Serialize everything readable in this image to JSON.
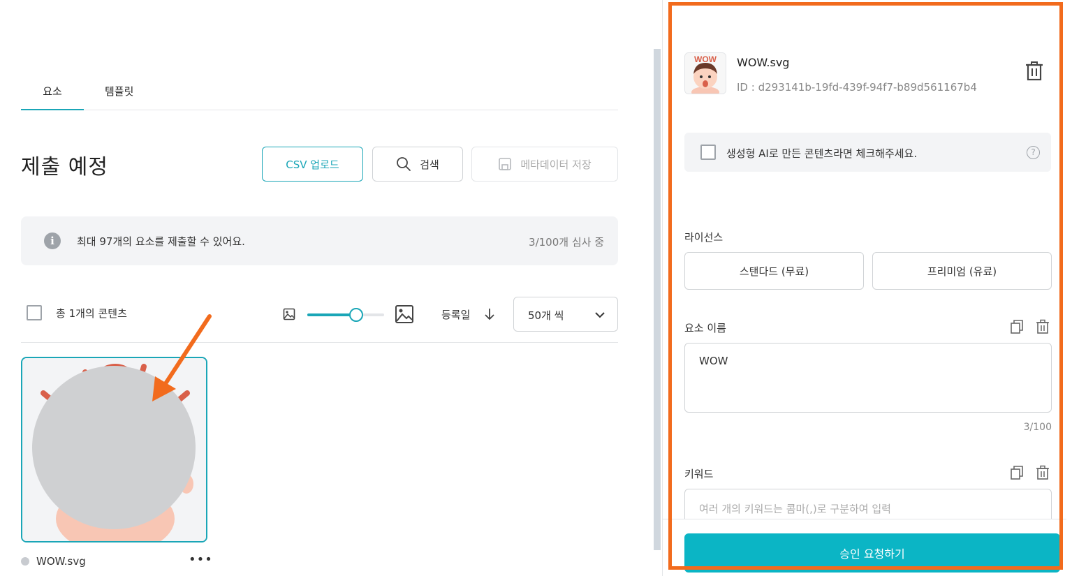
{
  "tabs": [
    {
      "label": "요소"
    },
    {
      "label": "템플릿"
    }
  ],
  "page_title": "제출 예정",
  "toolbar": {
    "csv_upload": "CSV 업로드",
    "search": "검색",
    "save_metadata": "메타데이터 저장"
  },
  "info": {
    "message": "최대 97개의 요소를 제출할 수 있어요.",
    "review_count": "3/100개 심사 중"
  },
  "list_controls": {
    "total_label": "총 1개의 콘텐츠",
    "size_slider_value": 0.64,
    "sort_label": "등록일",
    "per_page": "50개 씩"
  },
  "content_items": [
    {
      "name": "WOW.svg",
      "selected": true
    }
  ],
  "detail": {
    "file_name": "WOW.svg",
    "file_id": "ID : d293141b-19fd-439f-94f7-b89d561167b4",
    "ai_checkbox_label": "생성형 AI로 만든 콘텐츠라면 체크해주세요.",
    "ai_help": "?",
    "license_label": "라이선스",
    "license_options": [
      "스탠다드 (무료)",
      "프리미엄 (유료)"
    ],
    "name_label": "요소 이름",
    "name_value": "WOW",
    "name_count": "3/100",
    "keyword_label": "키워드",
    "keyword_placeholder": "여러 개의 키워드는 콤마(,)로 구분하여 입력",
    "approve_button": "승인 요청하기"
  },
  "thumb_label": "WOW",
  "colors": {
    "accent": "#1aa6b7",
    "approve": "#0bb5c5",
    "highlight": "#f26b1d",
    "info_bg": "#f3f4f6"
  }
}
